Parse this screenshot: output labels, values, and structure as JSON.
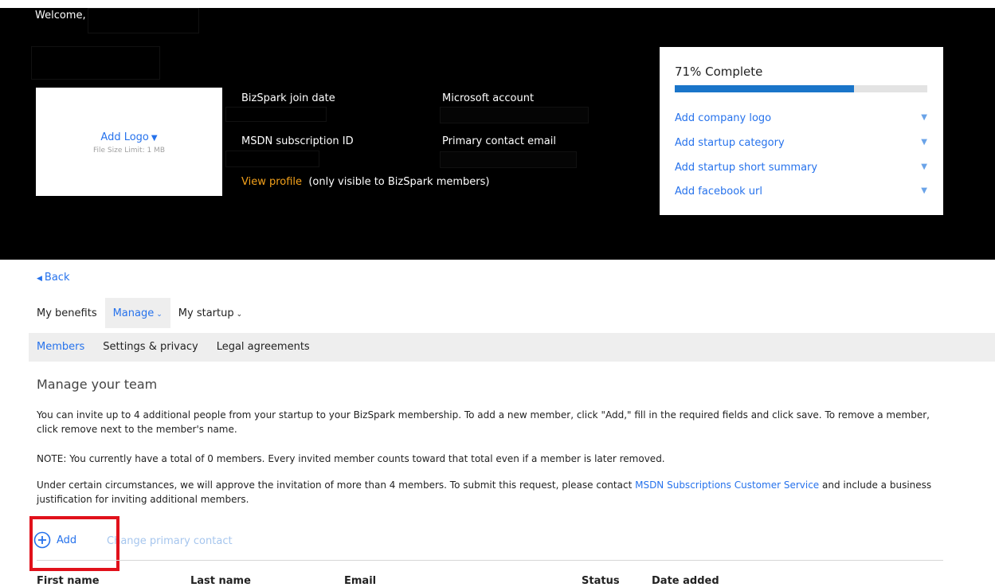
{
  "header": {
    "welcome": "Welcome,",
    "logo": {
      "add_logo": "Add Logo",
      "file_limit": "File Size Limit: 1 MB"
    },
    "fields": {
      "join_date_label": "BizSpark join date",
      "msdn_id_label": "MSDN subscription ID",
      "microsoft_account_label": "Microsoft account",
      "primary_email_label": "Primary contact email"
    },
    "view_profile": {
      "link": "View profile",
      "note": "(only visible to BizSpark members)"
    }
  },
  "profile_progress": {
    "percent": 71,
    "label": "71% Complete",
    "tasks": [
      {
        "label": "Add company logo"
      },
      {
        "label": "Add startup category"
      },
      {
        "label": "Add startup short summary"
      },
      {
        "label": "Add facebook url"
      }
    ]
  },
  "nav": {
    "back": "Back",
    "tabs": [
      {
        "label": "My benefits",
        "active": false,
        "dropdown": false
      },
      {
        "label": "Manage",
        "active": true,
        "dropdown": true
      },
      {
        "label": "My startup",
        "active": false,
        "dropdown": true
      }
    ],
    "subtabs": [
      {
        "label": "Members",
        "active": true
      },
      {
        "label": "Settings & privacy",
        "active": false
      },
      {
        "label": "Legal agreements",
        "active": false
      }
    ]
  },
  "content": {
    "title": "Manage your team",
    "intro": "You can invite up to 4 additional people from your startup to your BizSpark membership. To add a new member, click \"Add,\" fill in the required fields and click save. To remove a member, click remove next to the member's name.",
    "note": "NOTE: You currently have a total of 0 members. Every invited member counts toward that total even if a member is later removed.",
    "extra_before": "Under certain circumstances, we will approve the invitation of more than 4 members. To submit this request, please contact ",
    "extra_link": "MSDN Subscriptions Customer Service",
    "extra_after": " and include a business justification for inviting additional members.",
    "add_label": "Add",
    "change_primary_label": "Change primary contact",
    "columns": [
      "First name",
      "Last name",
      "Email",
      "Status",
      "Date added"
    ]
  },
  "colors": {
    "accent_blue": "#2672ec",
    "progress_blue": "#1a75c9",
    "header_bg": "#000000",
    "link_orange": "#f3a11b",
    "highlight_red": "#e1111b"
  },
  "icons": {
    "add": "plus-circle-icon",
    "dropdown": "triangle-down-icon",
    "back": "triangle-left-icon",
    "chevron": "chevron-down-icon"
  }
}
